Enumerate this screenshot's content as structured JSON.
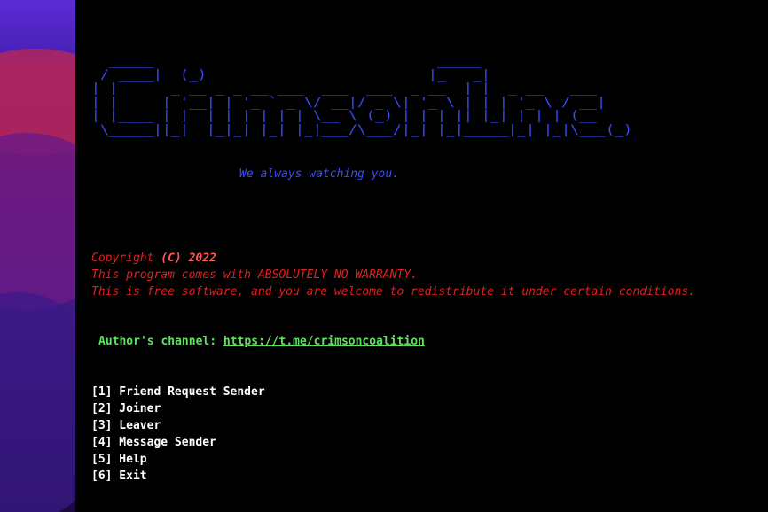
{
  "banner": {
    "ascii": "  _____                                _____              \n / ____|  (_)                         |_   _|             \n| |      _ __ _ _ __ ___  ___  ___  _ __  | |  _ __   ___  \n| |     | '__| | '_ ` _ \\/ __|/ _ \\| '_ \\ | | | '_ \\ / __| \n| |____ | |  | | | | | | \\__ \\ (_) | | | || |_| | | | (__  \n \\_____||_|  |_|_| |_| |_|___/\\___/|_| |_|_____|_| |_|\\___(_)",
    "tagline": "We always watching you."
  },
  "license": {
    "copyright_prefix": "Copyright ",
    "copyright_symbol": "(C)",
    "copyright_year": " 2022",
    "warranty": "This program comes with ABSOLUTELY NO WARRANTY.",
    "free_software": "This is free software, and you are welcome to redistribute it under certain conditions."
  },
  "author": {
    "label": "Author's channel: ",
    "link": "https://t.me/crimsoncoalition"
  },
  "menu": {
    "items": [
      "[1] Friend Request Sender",
      "[2] Joiner",
      "[3] Leaver",
      "[4] Message Sender",
      "[5] Help",
      "[6] Exit"
    ]
  },
  "colors": {
    "banner": "#3b4bff",
    "license": "#e0211f",
    "author": "#5ee35e",
    "menu": "#ffffff",
    "background": "#000000"
  }
}
